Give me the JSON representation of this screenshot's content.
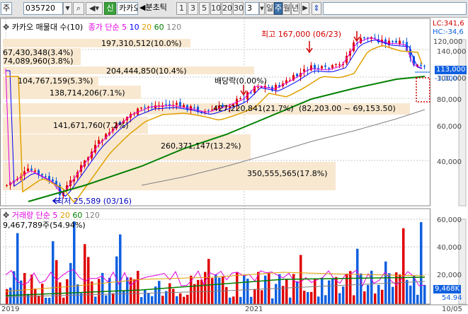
{
  "toolbar": {
    "market": "주",
    "code": "035720",
    "new_badge": "신",
    "name": "카카오",
    "interval_label": "분초틱",
    "intervals": [
      "1",
      "3",
      "5",
      "10",
      "20",
      "30"
    ],
    "period_count": "3",
    "periods": [
      "일",
      "주",
      "월",
      "년"
    ],
    "active_period": "주"
  },
  "price_legend": {
    "title": "카카오 매물대 수(10)",
    "ma_title": "종가 단순",
    "ma_periods": [
      "5",
      "10",
      "20",
      "60",
      "120"
    ],
    "ma_colors": [
      "#e000e0",
      "#0000ff",
      "#e0a000",
      "#008000",
      "#808080"
    ]
  },
  "price_axis": {
    "labels": [
      "140,000",
      "120,000",
      "100,000",
      "80,000",
      "60,000",
      "40,000"
    ],
    "current_price": "113,000",
    "lc": "LC:341,6",
    "hc": "HC:-34,6",
    "minus_label": "-3,000"
  },
  "annotations": {
    "high": "최고 167,000 (06/23)",
    "low": "최저 25,589 (03/16)",
    "dividend": "배당락(0.00%)",
    "range": "(82,203.00 ~ 69,153.50)"
  },
  "volume_profile": [
    {
      "label": "197,310,512(10.0%)"
    },
    {
      "label": "67,430,348(3.4%)"
    },
    {
      "label": "74,089,960(3.8%)"
    },
    {
      "label": "204,444,850(10.4%)"
    },
    {
      "label": "104,767,159(5.3%)"
    },
    {
      "label": "138,714,206(7.1%)"
    },
    {
      "label": "427,220,841(21.7%)"
    },
    {
      "label": "141,671,760(7.2%)"
    },
    {
      "label": "260,371,147(13.2%)"
    },
    {
      "label": "350,555,565(17.8%)"
    }
  ],
  "volume_legend": {
    "title": "거래량 단순",
    "periods": [
      "5",
      "20",
      "60",
      "120"
    ],
    "colors": [
      "#e000e0",
      "#e0a000",
      "#008000",
      "#808080"
    ],
    "last_volume": "9,467,789주(54.94%)"
  },
  "volume_axis": {
    "labels": [
      "60,000",
      "40,000",
      "20,000"
    ],
    "current": "9,468K",
    "pct": "54.94"
  },
  "time_axis": {
    "labels": [
      "2019",
      "2021",
      "10/05"
    ]
  },
  "colors": {
    "up": "#e00000",
    "down": "#1060e0",
    "profile": "#f8e8d0",
    "ma5": "#e000e0",
    "ma10": "#0000ff",
    "ma20": "#e0a000",
    "ma60": "#008000",
    "ma120": "#808080"
  }
}
